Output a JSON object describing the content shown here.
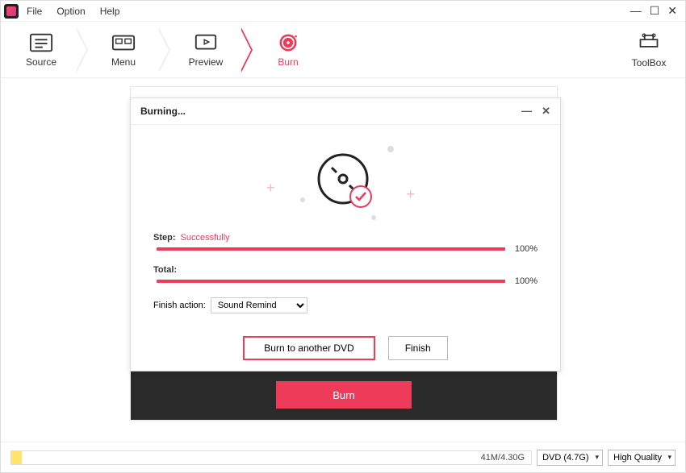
{
  "menu": {
    "file": "File",
    "option": "Option",
    "help": "Help"
  },
  "steps": {
    "source": "Source",
    "menu": "Menu",
    "preview": "Preview",
    "burn": "Burn",
    "toolbox": "ToolBox"
  },
  "dialog": {
    "title": "Burning...",
    "step_label": "Step:",
    "step_status": "Successfully",
    "step_pct": "100%",
    "total_label": "Total:",
    "total_pct": "100%",
    "finish_action_label": "Finish action:",
    "finish_action_value": "Sound Remind",
    "burn_another": "Burn to another DVD",
    "finish": "Finish"
  },
  "main_burn_button": "Burn",
  "status": {
    "size": "41M/4.30G",
    "disc_type": "DVD (4.7G)",
    "quality": "High Quality"
  }
}
